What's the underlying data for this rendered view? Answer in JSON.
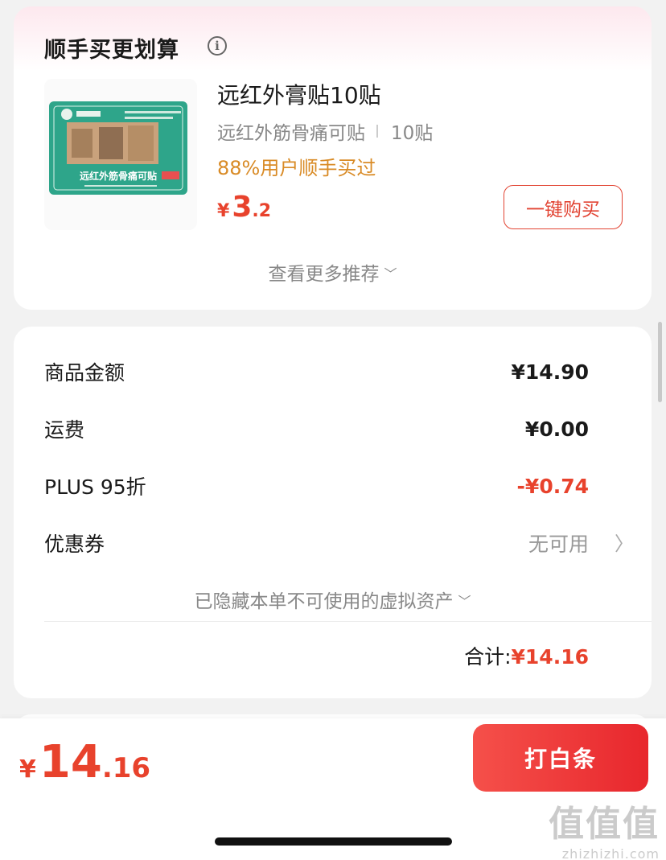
{
  "bundle": {
    "title": "顺手买更划算",
    "info_glyph": "i",
    "product": {
      "thumb_text": "远红外筋骨痛可贴",
      "name": "远红外膏贴10贴",
      "spec_name": "远红外筋骨痛可贴",
      "spec_count": "10贴",
      "tag": "88%用户顺手买过",
      "price_currency": "¥",
      "price_int": "3",
      "price_dec": ".2",
      "buy_label": "一键购买"
    },
    "more_label": "查看更多推荐"
  },
  "summary": {
    "rows": [
      {
        "label": "商品金额",
        "value": "¥14.90"
      },
      {
        "label": "运费",
        "value": "¥0.00"
      },
      {
        "label": "PLUS 95折",
        "value": "-¥0.74"
      },
      {
        "label": "优惠券",
        "value": "无可用"
      }
    ],
    "hidden_assets": "已隐藏本单不可使用的虚拟资产",
    "total_label": "合计:",
    "total_value": "¥14.16"
  },
  "bottom": {
    "currency": "¥",
    "int": "14",
    "dec": ".16",
    "pay_label": "打白条"
  },
  "watermark": {
    "big": "值值值",
    "small": "zhizhizhi.com"
  },
  "colors": {
    "accent_red": "#e8422c",
    "tag_orange": "#d98b26",
    "button_red": "#e8272d"
  }
}
